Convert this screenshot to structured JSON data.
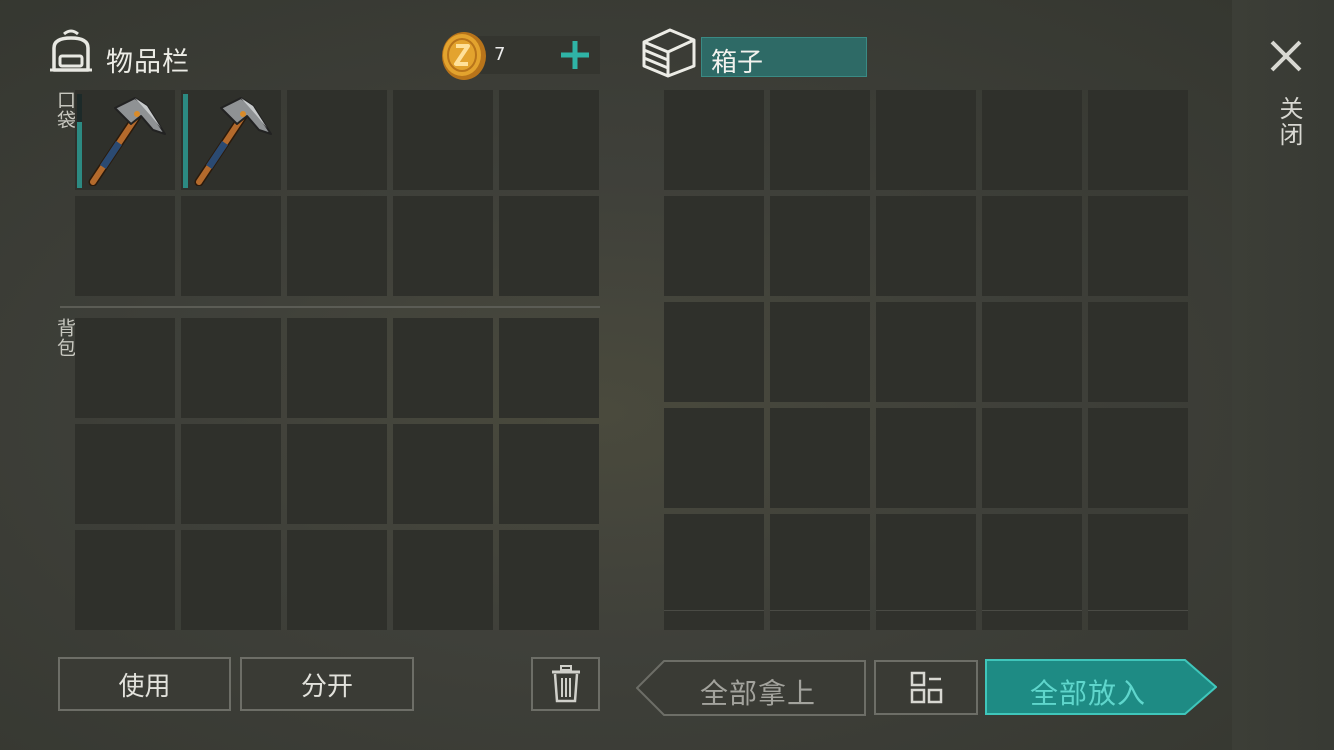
{
  "inventory": {
    "title": "物品栏",
    "pocket_label": "口袋",
    "bag_label": "背包",
    "pocket_slots": [
      {
        "item": "pickaxe-icon",
        "durability": 0.7
      },
      {
        "item": "pickaxe-icon",
        "durability": 1.0
      },
      {},
      {},
      {},
      {},
      {},
      {},
      {},
      {}
    ],
    "bag_slots": 15
  },
  "currency": {
    "icon": "coin-icon",
    "count": "7",
    "add_icon": "plus-icon"
  },
  "container": {
    "icon": "box-stack-icon",
    "title": "箱子",
    "slots_full_rows": 25,
    "slots_partial_row": 5
  },
  "close": {
    "icon": "close-icon",
    "label": "关闭"
  },
  "buttons": {
    "use": "使用",
    "split": "分开",
    "trash_icon": "trash-icon",
    "take_all": "全部拿上",
    "sort_icon": "sort-icon",
    "put_all": "全部放入"
  },
  "colors": {
    "accent_teal": "#2c8a82",
    "put_all_bg": "#1f8f88",
    "title_bg": "#2e6a66"
  }
}
